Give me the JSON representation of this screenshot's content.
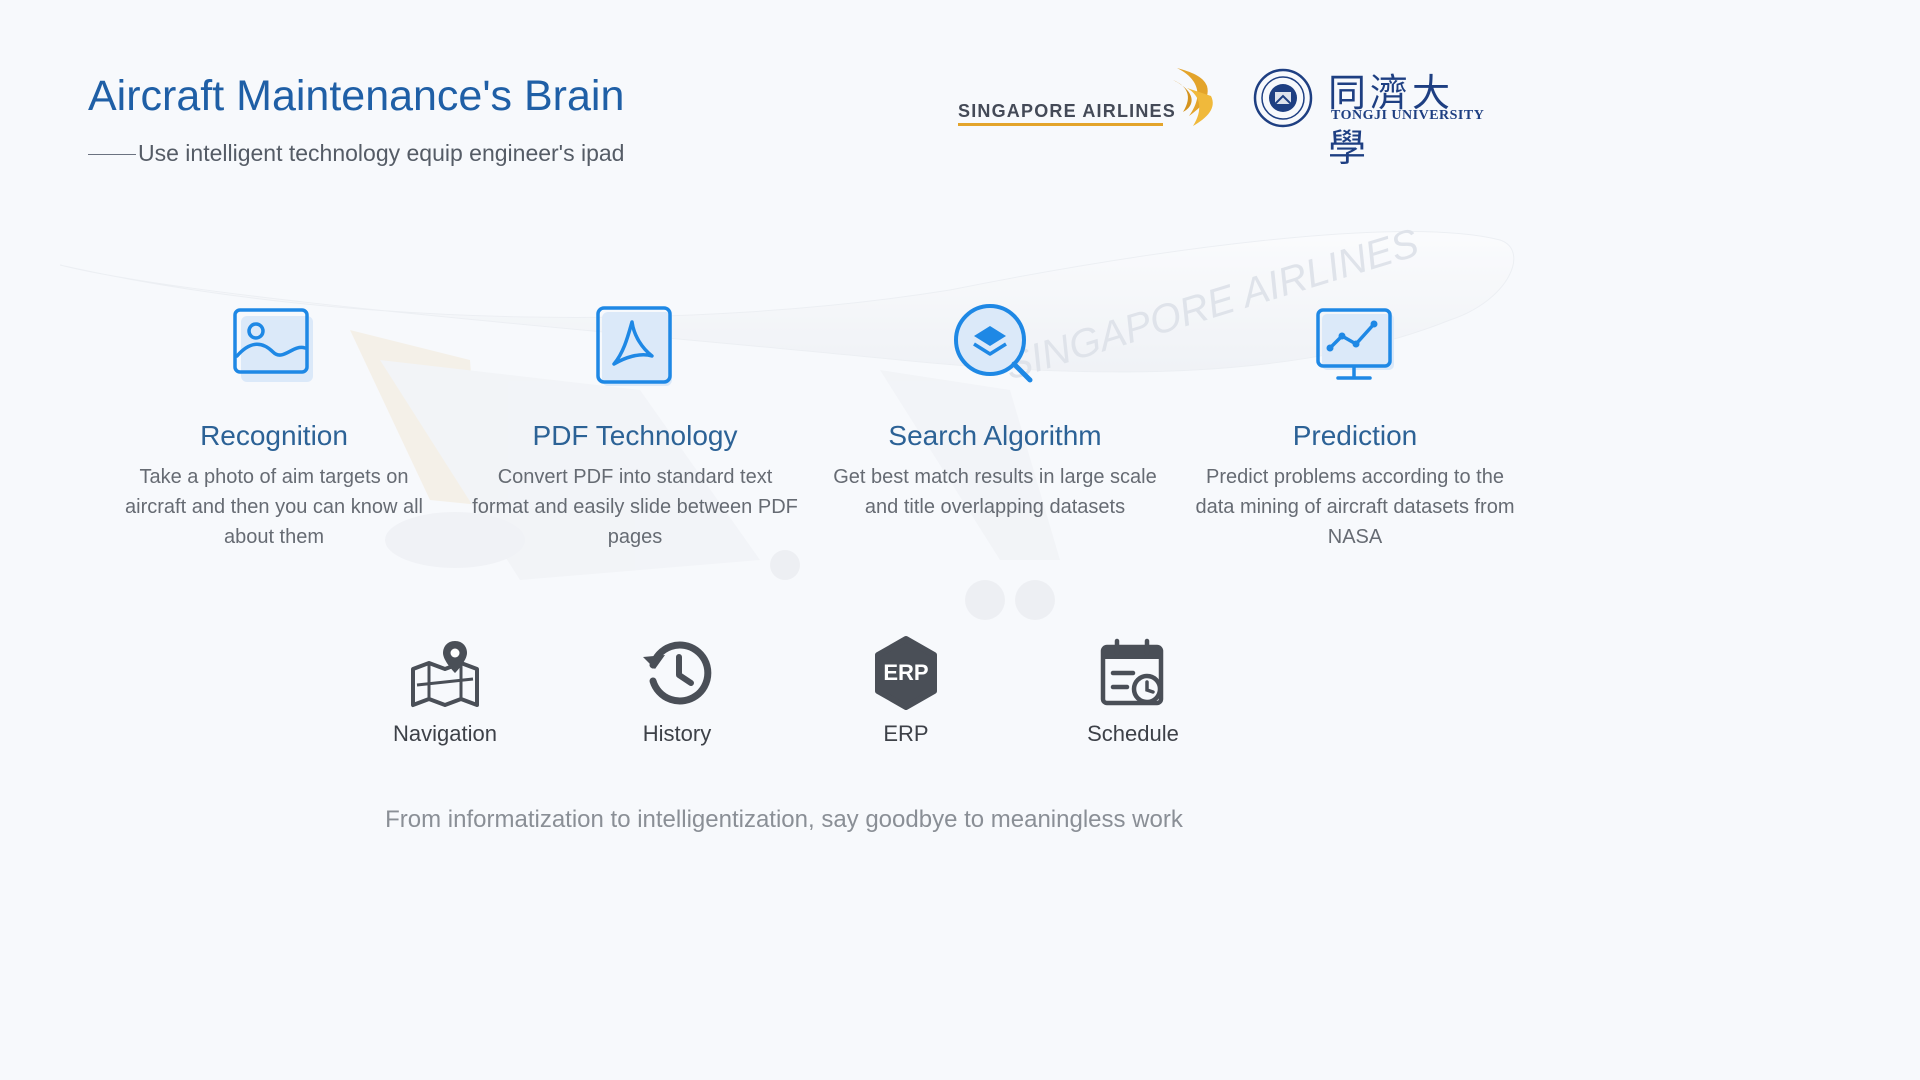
{
  "header": {
    "title": "Aircraft Maintenance's Brain",
    "subtitle": "Use intelligent technology equip engineer's ipad"
  },
  "logos": {
    "singapore_airlines": "SINGAPORE AIRLINES",
    "tongji_cn": "同濟大學",
    "tongji_en": "TONGJI UNIVERSITY",
    "background_livery": "SINGAPORE AIRLINES"
  },
  "features": [
    {
      "icon": "image-icon",
      "title": "Recognition",
      "description": "Take a photo of aim targets on aircraft and then you can know all about them"
    },
    {
      "icon": "pdf-icon",
      "title": "PDF Technology",
      "description": "Convert PDF into standard text format and easily slide between PDF pages"
    },
    {
      "icon": "search-layers-icon",
      "title": "Search Algorithm",
      "description": "Get best match results in large scale and title overlapping datasets"
    },
    {
      "icon": "chart-monitor-icon",
      "title": "Prediction",
      "description": "Predict problems according to the data mining of aircraft datasets from NASA"
    }
  ],
  "tools": [
    {
      "icon": "map-pin-icon",
      "label": "Navigation"
    },
    {
      "icon": "history-icon",
      "label": "History"
    },
    {
      "icon": "erp-icon",
      "label": "ERP",
      "badge": "ERP"
    },
    {
      "icon": "calendar-clock-icon",
      "label": "Schedule"
    }
  ],
  "footer": "From informatization to intelligentization, say goodbye to meaningless work",
  "colors": {
    "title": "#1f5fa6",
    "feature_title": "#2c6296",
    "icon_blue": "#1e88e5",
    "icon_fill": "#dbe9f9",
    "tool_icon": "#4a4f57",
    "sia_gold": "#e3a42b",
    "tongji_blue": "#1e3f82"
  }
}
